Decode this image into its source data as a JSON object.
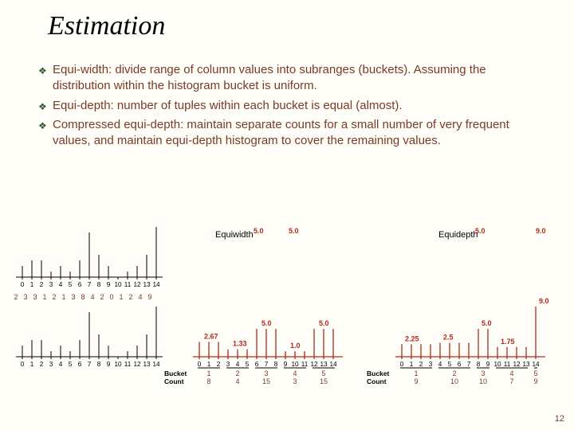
{
  "title": "Estimation",
  "bullets": [
    "Equi-width: divide  range of column values into subranges (buckets). Assuming the distribution within the histogram bucket is uniform.",
    "Equi-depth: number of tuples within each bucket is equal (almost).",
    "Compressed equi-depth: maintain separate counts for a small number of very frequent values, and maintain equi-depth histogram to cover the remaining values."
  ],
  "page_number": "12",
  "chart_data": [
    {
      "name": "raw",
      "type": "bar",
      "label": "",
      "categories": [
        "0",
        "1",
        "2",
        "3",
        "4",
        "5",
        "6",
        "7",
        "8",
        "9",
        "10",
        "11",
        "12",
        "13",
        "14"
      ],
      "raw_values": [
        2,
        3,
        3,
        1,
        2,
        1,
        3,
        8,
        4,
        2,
        0,
        1,
        2,
        4,
        9
      ],
      "top_labels": [
        "2",
        "3",
        "3",
        "1",
        "2",
        "1",
        "3",
        "8",
        "4",
        "2",
        "0",
        "1",
        "2",
        "4",
        "9"
      ]
    },
    {
      "name": "equiwidth",
      "type": "bar",
      "label": "Equiwidth",
      "categories": [
        "0",
        "1",
        "2",
        "3",
        "4",
        "5",
        "6",
        "7",
        "8",
        "9",
        "10",
        "11",
        "12",
        "13",
        "14"
      ],
      "heights": [
        2.67,
        2.67,
        2.67,
        1.33,
        1.33,
        1.33,
        5.0,
        5.0,
        5.0,
        1.0,
        1.0,
        1.0,
        5.0,
        5.0,
        5.0
      ],
      "bucket_avg_labels": {
        "0": "2.67",
        "3": "1.33",
        "6": "5.0",
        "9": "1.0",
        "12": "5.0"
      },
      "buckets": [
        {
          "id": "1",
          "range": [
            0,
            2
          ],
          "count": 8
        },
        {
          "id": "2",
          "range": [
            3,
            5
          ],
          "count": 4
        },
        {
          "id": "3",
          "range": [
            6,
            8
          ],
          "count": 15
        },
        {
          "id": "4",
          "range": [
            9,
            11
          ],
          "count": 3
        },
        {
          "id": "5",
          "range": [
            12,
            14
          ],
          "count": 15
        }
      ],
      "bucket_row_labels": {
        "Bucket": [
          "1",
          "2",
          "3",
          "4",
          "5"
        ],
        "Count": [
          "8",
          "4",
          "15",
          "3",
          "15"
        ]
      }
    },
    {
      "name": "equidepth",
      "type": "bar",
      "label": "Equidepth",
      "categories": [
        "0",
        "1",
        "2",
        "3",
        "4",
        "5",
        "6",
        "7",
        "8",
        "9",
        "10",
        "11",
        "12",
        "13",
        "14"
      ],
      "heights": [
        2.25,
        2.25,
        2.25,
        2.25,
        2.5,
        2.5,
        2.5,
        2.5,
        5.0,
        5.0,
        1.75,
        1.75,
        1.75,
        1.75,
        9.0
      ],
      "bucket_avg_labels": {
        "0": "2.25",
        "4": "2.5",
        "8": "5.0",
        "10": "1.75",
        "14": "9.0"
      },
      "buckets": [
        {
          "id": "1",
          "range": [
            0,
            3
          ],
          "count": 9
        },
        {
          "id": "2",
          "range": [
            4,
            7
          ],
          "count": 10
        },
        {
          "id": "3",
          "range": [
            8,
            9
          ],
          "count": 10
        },
        {
          "id": "4",
          "range": [
            10,
            13
          ],
          "count": 7
        },
        {
          "id": "5",
          "range": [
            14,
            14
          ],
          "count": 9
        }
      ],
      "bucket_row_labels": {
        "Bucket": [
          "1",
          "2",
          "3",
          "4",
          "5"
        ],
        "Count": [
          "9",
          "10",
          "10",
          "7",
          "9"
        ]
      }
    }
  ]
}
